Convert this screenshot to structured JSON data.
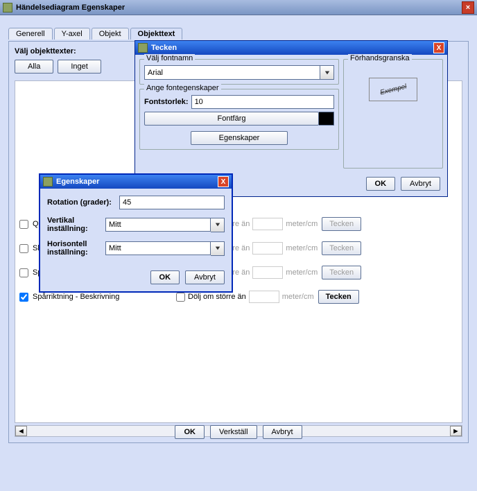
{
  "window": {
    "title": "Händelsediagram Egenskaper"
  },
  "tabs": {
    "generell": "Generell",
    "yaxel": "Y-axel",
    "objekt": "Objekt",
    "objekttext": "Objekttext"
  },
  "toppanel": {
    "label": "Välj objekttexter:",
    "alla": "Alla",
    "inget": "Inget"
  },
  "rows": {
    "r1": {
      "label": "Q+K",
      "dolj": "större än",
      "unit": "meter/cm",
      "btn": "Tecken"
    },
    "r2": {
      "label": "Slip",
      "dolj": "större än",
      "unit": "meter/cm",
      "btn": "Tecken"
    },
    "r3": {
      "label": "Spå",
      "dolj": "större än",
      "unit": "meter/cm",
      "btn": "Tecken"
    },
    "r4": {
      "label": "Spårriktning - Beskrivning",
      "dolj": "Dölj om större än",
      "unit": "meter/cm",
      "btn": "Tecken"
    }
  },
  "footer": {
    "ok": "OK",
    "verkstall": "Verkställ",
    "avbryt": "Avbryt"
  },
  "tecken": {
    "title": "Tecken",
    "fontname_label": "Välj fontnamn",
    "fontname_value": "Arial",
    "fontprops_label": "Ange fontegenskaper",
    "size_label": "Fontstorlek:",
    "size_value": "10",
    "color_label": "Fontfärg",
    "egenskaper_btn": "Egenskaper",
    "preview_label": "Förhandsgranska",
    "preview_text": "Exempel",
    "ok": "OK",
    "avbryt": "Avbryt"
  },
  "egenskaper": {
    "title": "Egenskaper",
    "rotation_label": "Rotation (grader):",
    "rotation_value": "45",
    "vert_label": "Vertikal inställning:",
    "vert_value": "Mitt",
    "horiz_label": "Horisontell inställning:",
    "horiz_value": "Mitt",
    "ok": "OK",
    "avbryt": "Avbryt"
  }
}
